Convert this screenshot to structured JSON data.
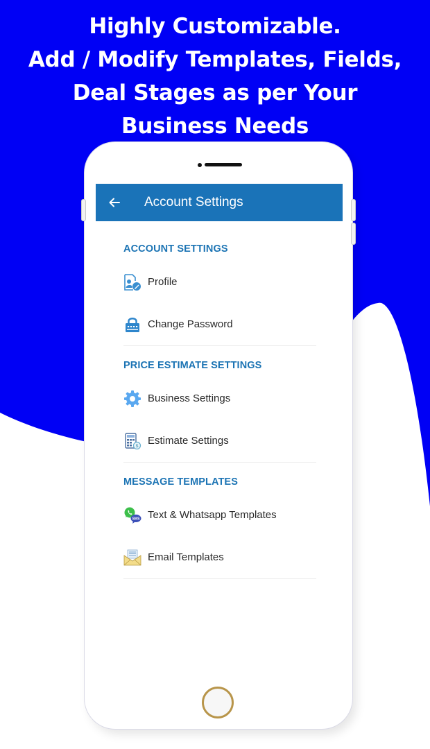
{
  "colors": {
    "background_blue": "#0000f5",
    "appbar": "#1a73b8",
    "section_title": "#1c74b4",
    "text": "#2a2a2a"
  },
  "headline": {
    "lines": [
      "Highly Customizable.",
      "Add / Modify Templates, Fields,",
      "Deal Stages as per Your",
      "Business Needs"
    ]
  },
  "appbar": {
    "back_icon": "arrow-left-icon",
    "title": "Account Settings"
  },
  "sections": [
    {
      "title": "ACCOUNT SETTINGS",
      "items": [
        {
          "label": "Profile",
          "icon": "profile-edit-icon"
        },
        {
          "label": "Change Password",
          "icon": "lock-icon"
        }
      ]
    },
    {
      "title": "PRICE ESTIMATE SETTINGS",
      "items": [
        {
          "label": "Business Settings",
          "icon": "gear-icon"
        },
        {
          "label": "Estimate Settings",
          "icon": "calculator-icon"
        }
      ]
    },
    {
      "title": "MESSAGE TEMPLATES",
      "items": [
        {
          "label": "Text & Whatsapp Templates",
          "icon": "whatsapp-sms-icon"
        },
        {
          "label": "Email Templates",
          "icon": "envelope-icon"
        }
      ]
    }
  ]
}
